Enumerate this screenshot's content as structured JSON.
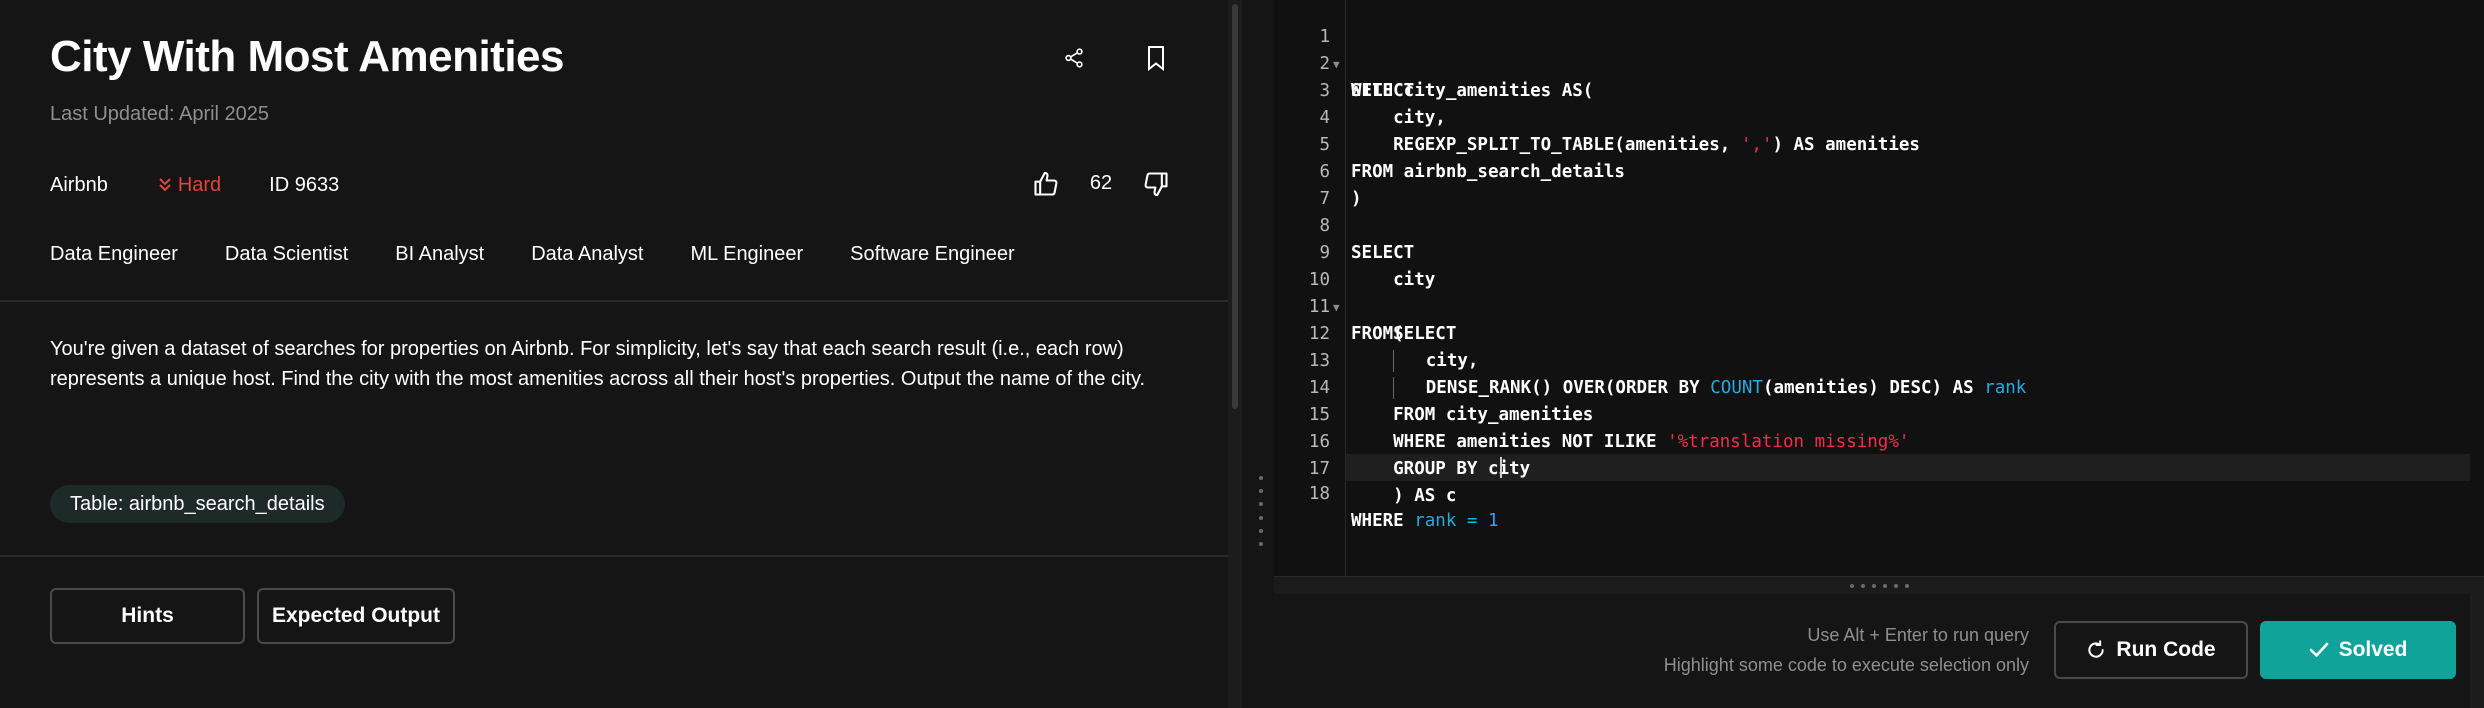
{
  "question": {
    "title": "City With Most Amenities",
    "last_updated": "Last Updated: April 2025",
    "company": "Airbnb",
    "difficulty": "Hard",
    "id_label": "ID 9633",
    "likes": "62",
    "roles": [
      "Data Engineer",
      "Data Scientist",
      "BI Analyst",
      "Data Analyst",
      "ML Engineer",
      "Software Engineer"
    ],
    "description": "You're given a dataset of searches for properties on Airbnb. For simplicity, let's say that each search result (i.e., each row) represents a unique host. Find the city with the most amenities across all their host's properties. Output the name of the city.",
    "table_chip": "Table: airbnb_search_details",
    "hints_label": "Hints",
    "expected_output_label": "Expected Output"
  },
  "icons": {
    "share": "share-icon",
    "bookmark": "bookmark-icon",
    "difficulty": "double-chevron-down-icon",
    "thumbs_up": "thumbs-up-icon",
    "thumbs_down": "thumbs-down-icon",
    "run": "refresh-icon",
    "solved": "check-icon"
  },
  "colors": {
    "accent": "#10a39a",
    "difficulty_hard": "#e0443e",
    "sql_function": "#29a9e1",
    "sql_string": "#f0304a"
  },
  "editor": {
    "line_numbers": [
      "1",
      "2",
      "3",
      "4",
      "5",
      "6",
      "7",
      "8",
      "9",
      "10",
      "11",
      "12",
      "13",
      "14",
      "15",
      "16",
      "17",
      "18"
    ],
    "lines": {
      "l1": "WITH city_amenities AS(",
      "l2": "SELECT",
      "l3": "    city,",
      "l4a": "    REGEXP_SPLIT_TO_TABLE(amenities, ",
      "l4b": "','",
      "l4c": ") AS amenities",
      "l5": "FROM airbnb_search_details",
      "l6": ")",
      "l7": "",
      "l8": "SELECT",
      "l9": "    city",
      "l10": "FROM(",
      "l11": "    SELECT",
      "l12": "city,",
      "l13a": "DENSE_RANK() OVER(ORDER BY ",
      "l13b": "COUNT",
      "l13c": "(amenities) DESC) AS ",
      "l13d": "rank",
      "l14": "    FROM city_amenities",
      "l15a": "    WHERE amenities NOT ILIKE ",
      "l15b": "'%translation missing%'",
      "l16": "    GROUP BY city",
      "l17": "    ) AS c",
      "l18a": "WHERE ",
      "l18b": "rank",
      "l18c": " = ",
      "l18d": "1"
    }
  },
  "footer": {
    "hint_run": "Use Alt + Enter to run query",
    "hint_selection": "Highlight some code to execute selection only",
    "run_label": "Run Code",
    "solved_label": "Solved"
  }
}
